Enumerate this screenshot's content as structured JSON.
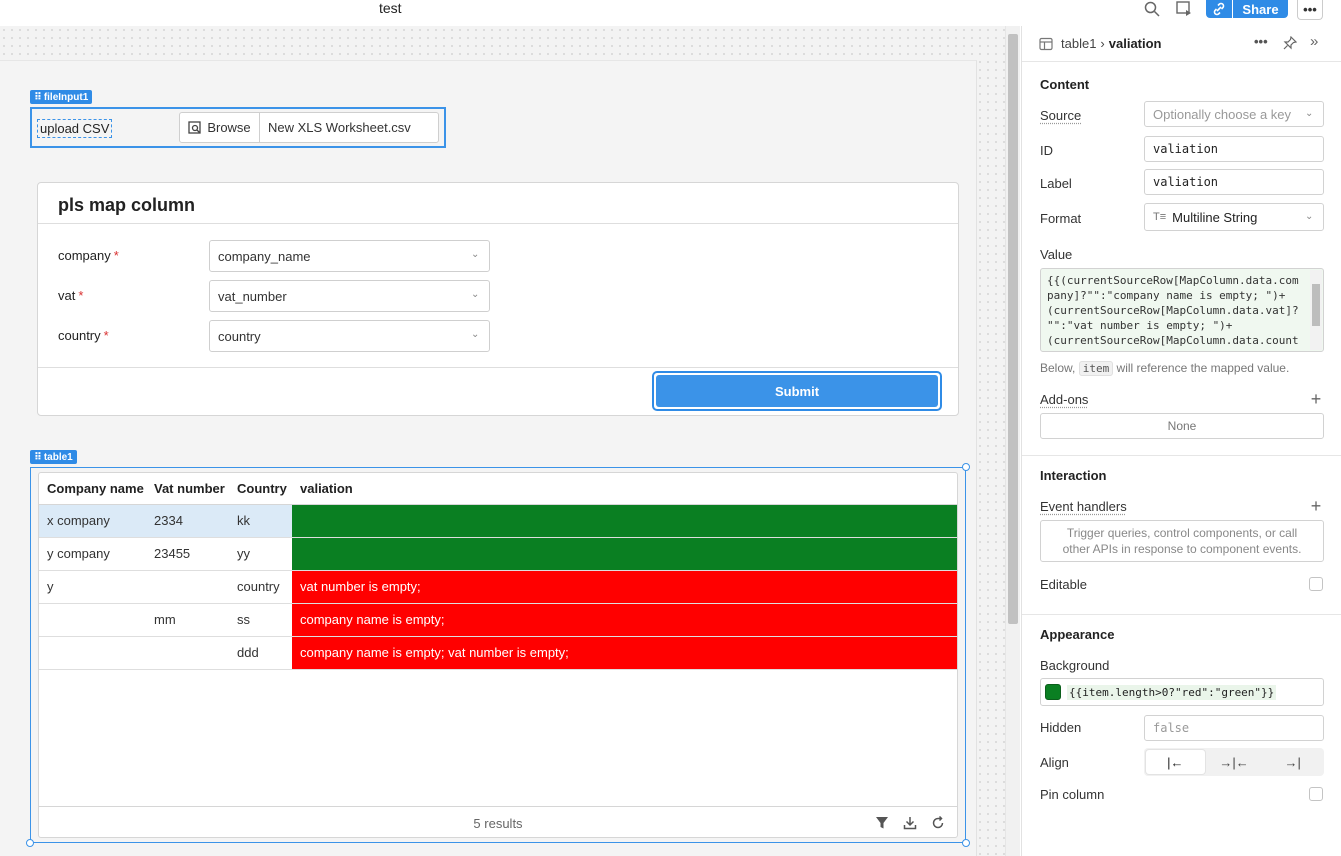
{
  "app": {
    "title": "test"
  },
  "topbar": {
    "share_label": "Share",
    "more_label": "•••"
  },
  "canvas": {
    "file_input": {
      "tag": "fileInput1",
      "label": "upload CSV",
      "browse_label": "Browse",
      "file_name": "New XLS Worksheet.csv"
    },
    "form": {
      "title": "pls map column",
      "fields": [
        {
          "label": "company",
          "value": "company_name"
        },
        {
          "label": "vat",
          "value": "vat_number"
        },
        {
          "label": "country",
          "value": "country"
        }
      ],
      "required_mark": "*",
      "submit_label": "Submit"
    },
    "table": {
      "tag": "table1",
      "columns": [
        "Company name",
        "Vat number",
        "Country",
        "valiation"
      ],
      "rows": [
        {
          "company": "x company",
          "vat": "2334",
          "country": "kk",
          "valiation": "",
          "status": "ok"
        },
        {
          "company": "y company",
          "vat": "23455",
          "country": "yy",
          "valiation": "",
          "status": "ok"
        },
        {
          "company": "y",
          "vat": "",
          "country": "country",
          "valiation": "vat number is empty;",
          "status": "bad"
        },
        {
          "company": "",
          "vat": "mm",
          "country": "ss",
          "valiation": "company name is empty;",
          "status": "bad"
        },
        {
          "company": "",
          "vat": "",
          "country": "ddd",
          "valiation": "company name is empty; vat number is empty;",
          "status": "bad"
        }
      ],
      "footer_count": "5 results",
      "colors": {
        "ok": "#0a7f22",
        "bad": "#ff0000"
      }
    }
  },
  "panel": {
    "breadcrumb": {
      "parent": "table1",
      "separator": "›",
      "current": "valiation"
    },
    "content": {
      "title": "Content",
      "source_label": "Source",
      "source_placeholder": "Optionally choose a key",
      "id_label": "ID",
      "id_value": "valiation",
      "label_label": "Label",
      "label_value": "valiation",
      "format_label": "Format",
      "format_value": "Multiline String",
      "value_label": "Value",
      "value_lines": [
        "{{(currentSourceRow[MapColumn.data.com",
        "pany]?\"\":\"company name is empty; \")+",
        "(currentSourceRow[MapColumn.data.vat]?",
        "\"\":\"vat number is empty; \")+",
        "(currentSourceRow[MapColumn.data.count"
      ],
      "hint_before": "Below,",
      "hint_code": "item",
      "hint_after": "will reference the mapped value.",
      "addons_label": "Add-ons",
      "addons_value": "None"
    },
    "interaction": {
      "title": "Interaction",
      "event_handlers_label": "Event handlers",
      "event_handlers_empty": "Trigger queries, control components, or call other APIs in response to component events.",
      "editable_label": "Editable"
    },
    "appearance": {
      "title": "Appearance",
      "background_label": "Background",
      "background_value": "{{item.length>0?\"red\":\"green\"}}",
      "background_swatch": "#0a7f22",
      "hidden_label": "Hidden",
      "hidden_placeholder": "false",
      "align_label": "Align",
      "align_options": [
        "|←",
        "→|←",
        "→|"
      ],
      "pin_label": "Pin column"
    }
  }
}
